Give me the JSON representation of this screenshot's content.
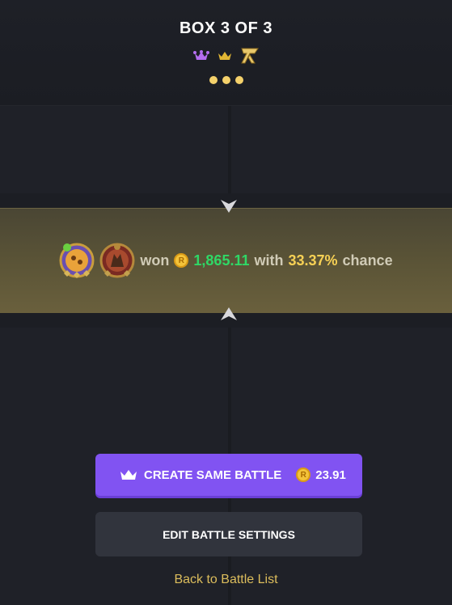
{
  "header": {
    "title": "BOX 3 OF 3",
    "mode_icons": [
      "jester-icon",
      "crown-icon",
      "r-logo-icon"
    ],
    "progress_dots": 3
  },
  "result": {
    "won_word": "won",
    "amount": "1,865.11",
    "with_word": "with",
    "chance_value": "33.37%",
    "chance_word": "chance"
  },
  "actions": {
    "create_label": "CREATE SAME BATTLE",
    "create_price": "23.91",
    "edit_label": "EDIT BATTLE SETTINGS",
    "back_label": "Back to Battle List"
  },
  "colors": {
    "accent_purple": "#8153f2",
    "win_green": "#2fd866",
    "chance_yellow": "#f7d155",
    "link_gold": "#dcbd5c"
  }
}
